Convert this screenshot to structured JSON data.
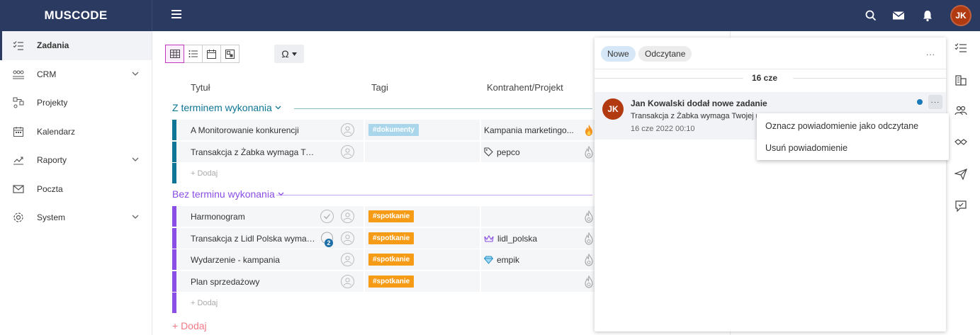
{
  "app": {
    "logo": "MUSCODE",
    "user_initials": "JK"
  },
  "topbar": {
    "icons": [
      "search-icon",
      "mail-icon",
      "bell-icon"
    ]
  },
  "sidebar": {
    "items": [
      {
        "label": "Zadania",
        "icon": "tasks-icon",
        "active": true,
        "has_chevron": false
      },
      {
        "label": "CRM",
        "icon": "crm-icon",
        "active": false,
        "has_chevron": true
      },
      {
        "label": "Projekty",
        "icon": "projects-icon",
        "active": false,
        "has_chevron": false
      },
      {
        "label": "Kalendarz",
        "icon": "calendar-icon",
        "active": false,
        "has_chevron": false
      },
      {
        "label": "Raporty",
        "icon": "reports-icon",
        "active": false,
        "has_chevron": true
      },
      {
        "label": "Poczta",
        "icon": "mail-icon",
        "active": false,
        "has_chevron": false
      },
      {
        "label": "System",
        "icon": "gear-icon",
        "active": false,
        "has_chevron": true
      }
    ]
  },
  "toolbar": {
    "views": [
      "table-view",
      "list-view",
      "calendar-view",
      "board-view"
    ],
    "active_view": "table-view"
  },
  "table": {
    "columns": {
      "title": "Tytuł",
      "tags": "Tagi",
      "client": "Kontrahent/Projekt"
    },
    "add_label": "+ Dodaj",
    "add_main": "+ Dodaj",
    "groups": [
      {
        "title": "Z terminem wykonania",
        "color": "#0e7694",
        "rows": [
          {
            "title": "A Monitorowanie konkurencji",
            "tag": "#dokumenty",
            "tag_type": "doc",
            "project": "Kampania marketingo...",
            "project_icon": "",
            "flame_active": true,
            "has_check": false,
            "comments": ""
          },
          {
            "title": "Transakcja z Żabka wymaga Twojej u...",
            "tag": "",
            "tag_type": "",
            "project": "pepco",
            "project_icon": "tag-icon",
            "flame_active": false,
            "has_check": false,
            "comments": ""
          }
        ]
      },
      {
        "title": "Bez terminu wykonania",
        "color": "#8a4de6",
        "rows": [
          {
            "title": "Harmonogram",
            "tag": "#spotkanie",
            "tag_type": "spot",
            "project": "",
            "project_icon": "",
            "flame_active": false,
            "has_check": true,
            "comments": ""
          },
          {
            "title": "Transakcja z Lidl Polska wymag...",
            "tag": "#spotkanie",
            "tag_type": "spot",
            "project": "lidl_polska",
            "project_icon": "crown-icon",
            "flame_active": false,
            "has_check": false,
            "comments": "2"
          },
          {
            "title": "Wydarzenie - kampania",
            "tag": "#spotkanie",
            "tag_type": "spot",
            "project": "empik",
            "project_icon": "diamond-icon",
            "flame_active": false,
            "has_check": false,
            "comments": ""
          },
          {
            "title": "Plan sprzedażowy",
            "tag": "#spotkanie",
            "tag_type": "spot",
            "project": "",
            "project_icon": "",
            "flame_active": false,
            "has_check": false,
            "comments": ""
          }
        ]
      }
    ]
  },
  "notifications": {
    "tab_new": "Nowe",
    "tab_read": "Odczytane",
    "more": "...",
    "date_group": "16 cze",
    "item": {
      "avatar": "JK",
      "title": "Jan Kowalski dodał nowe zadanie",
      "subtitle": "Transakcja z Żabka wymaga Twojej u",
      "time": "16 cze 2022 00:10",
      "more": "···"
    },
    "context_menu": {
      "mark_read": "Oznacz powiadomienie jako odczytane",
      "delete": "Usuń powiadomienie"
    }
  },
  "right_icons": [
    "tasks-icon",
    "building-icon",
    "people-icon",
    "handshake-icon",
    "send-icon",
    "chat-icon"
  ]
}
